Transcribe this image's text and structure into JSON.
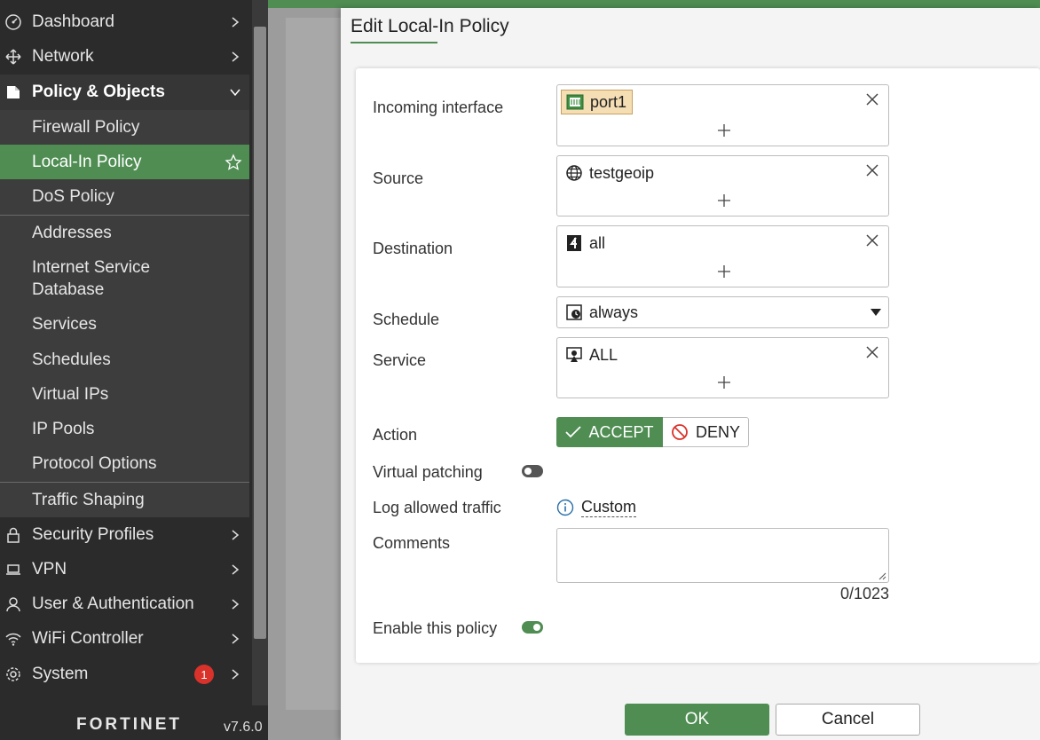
{
  "sidebar": {
    "items": [
      {
        "label": "Dashboard",
        "icon": "dashboard-icon"
      },
      {
        "label": "Network",
        "icon": "network-icon"
      },
      {
        "label": "Policy & Objects",
        "icon": "policy-icon"
      },
      {
        "label": "Firewall Policy"
      },
      {
        "label": "Local-In Policy"
      },
      {
        "label": "DoS Policy"
      },
      {
        "label": "Addresses"
      },
      {
        "label": "Internet Service Database"
      },
      {
        "label": "Services"
      },
      {
        "label": "Schedules"
      },
      {
        "label": "Virtual IPs"
      },
      {
        "label": "IP Pools"
      },
      {
        "label": "Protocol Options"
      },
      {
        "label": "Traffic Shaping"
      },
      {
        "label": "Security Profiles",
        "icon": "lock-icon"
      },
      {
        "label": "VPN",
        "icon": "laptop-icon"
      },
      {
        "label": "User & Authentication",
        "icon": "user-icon"
      },
      {
        "label": "WiFi Controller",
        "icon": "wifi-icon"
      },
      {
        "label": "System",
        "icon": "gear-icon",
        "badge": "1"
      }
    ],
    "logo": "FORTINET",
    "version": "v7.6.0"
  },
  "modal": {
    "title": "Edit Local-In Policy",
    "fields": {
      "incoming_interface": {
        "label": "Incoming interface",
        "value": "port1",
        "icon": "port-icon"
      },
      "source": {
        "label": "Source",
        "value": "testgeoip",
        "icon": "globe-icon"
      },
      "destination": {
        "label": "Destination",
        "value": "all",
        "icon": "address-icon"
      },
      "schedule": {
        "label": "Schedule",
        "value": "always",
        "icon": "schedule-icon"
      },
      "service": {
        "label": "Service",
        "value": "ALL",
        "icon": "service-icon"
      },
      "action": {
        "label": "Action",
        "accept": "ACCEPT",
        "deny": "DENY",
        "selected": "ACCEPT"
      },
      "virtual_patching": {
        "label": "Virtual patching",
        "enabled": false
      },
      "log_allowed_traffic": {
        "label": "Log allowed traffic",
        "value": "Custom"
      },
      "comments": {
        "label": "Comments",
        "value": "",
        "counter": "0/1023"
      },
      "enable_policy": {
        "label": "Enable this policy",
        "enabled": true
      }
    },
    "buttons": {
      "ok": "OK",
      "cancel": "Cancel"
    }
  },
  "colors": {
    "accent": "#4f8d53",
    "sidebar_bg": "#2b2b2b",
    "badge": "#d9322a"
  }
}
